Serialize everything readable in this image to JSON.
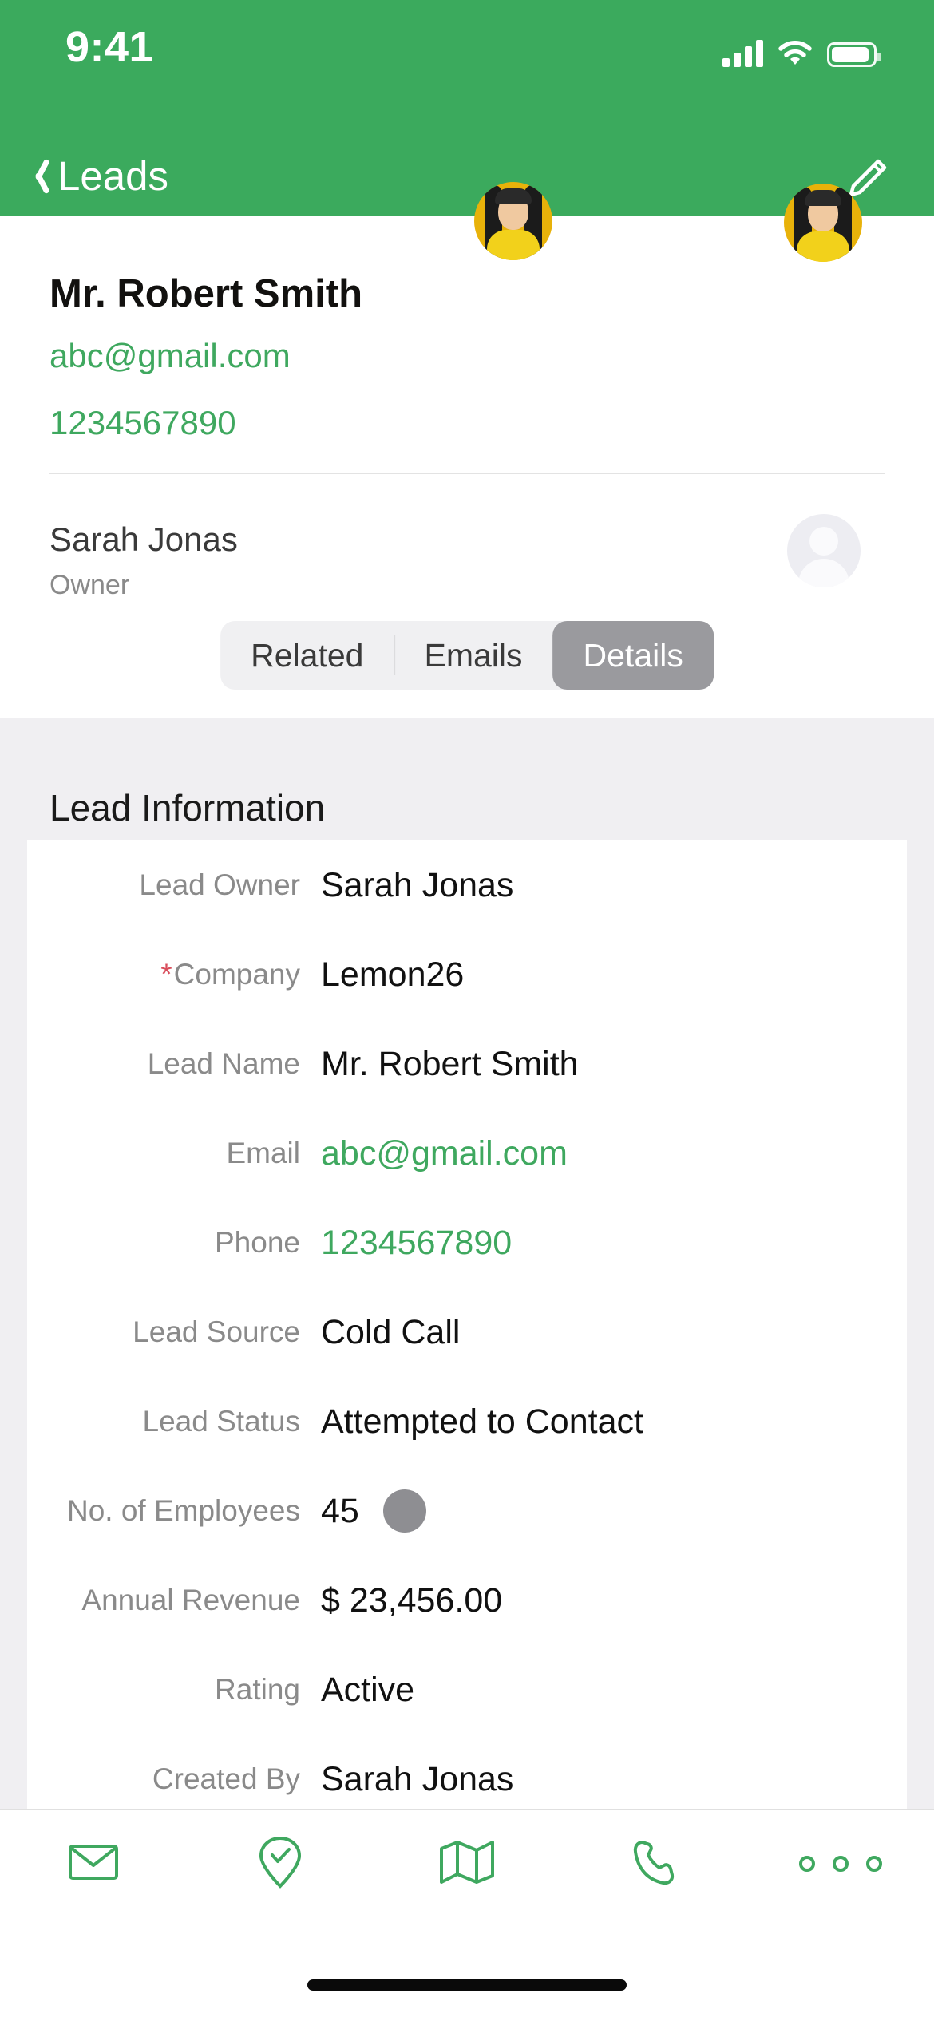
{
  "status_bar": {
    "time": "9:41",
    "signal_icon": "cellular-signal-icon",
    "wifi_icon": "wifi-icon",
    "battery_icon": "battery-icon"
  },
  "nav": {
    "back_icon": "chevron-left-icon",
    "back_label": "Leads",
    "edit_icon": "pencil-edit-icon"
  },
  "lead_header": {
    "name": "Mr. Robert Smith",
    "email": "abc@gmail.com",
    "phone": "1234567890",
    "avatar_icon": "lead-photo-avatar"
  },
  "owner": {
    "name": "Sarah Jonas",
    "role": "Owner",
    "avatar_icon": "person-placeholder-avatar"
  },
  "tabs": {
    "items": [
      {
        "label": "Related",
        "active": false
      },
      {
        "label": "Emails",
        "active": false
      },
      {
        "label": "Details",
        "active": true
      }
    ]
  },
  "details": {
    "section_title": "Lead Information",
    "fields": [
      {
        "label": "Lead Owner",
        "value": "Sarah Jonas",
        "required": false,
        "link": false
      },
      {
        "label": "Company",
        "value": "Lemon26",
        "required": true,
        "link": false
      },
      {
        "label": "Lead Name",
        "value": "Mr. Robert Smith",
        "required": false,
        "link": false
      },
      {
        "label": "Email",
        "value": "abc@gmail.com",
        "required": false,
        "link": true
      },
      {
        "label": "Phone",
        "value": "1234567890",
        "required": false,
        "link": true
      },
      {
        "label": "Lead Source",
        "value": "Cold Call",
        "required": false,
        "link": false
      },
      {
        "label": "Lead Status",
        "value": "Attempted to Contact",
        "required": false,
        "link": false
      },
      {
        "label": "No. of Employees",
        "value": "45",
        "required": false,
        "link": false,
        "indicator": true
      },
      {
        "label": "Annual Revenue",
        "value": "$ 23,456.00",
        "required": false,
        "link": false
      },
      {
        "label": "Rating",
        "value": "Active",
        "required": false,
        "link": false
      },
      {
        "label": "Created By",
        "value": "Sarah Jonas",
        "required": false,
        "link": false
      }
    ],
    "required_marker": "*"
  },
  "toolbar": {
    "items": [
      {
        "icon": "envelope-email-icon"
      },
      {
        "icon": "location-check-pin-icon"
      },
      {
        "icon": "map-icon"
      },
      {
        "icon": "phone-call-icon"
      },
      {
        "icon": "more-options-icon"
      }
    ]
  },
  "colors": {
    "brand_green": "#3BAA5D",
    "link_green": "#3FA85F",
    "required_red": "#D94E5C",
    "tab_active_bg": "#9A9A9E",
    "page_bg": "#F0EFF2"
  }
}
